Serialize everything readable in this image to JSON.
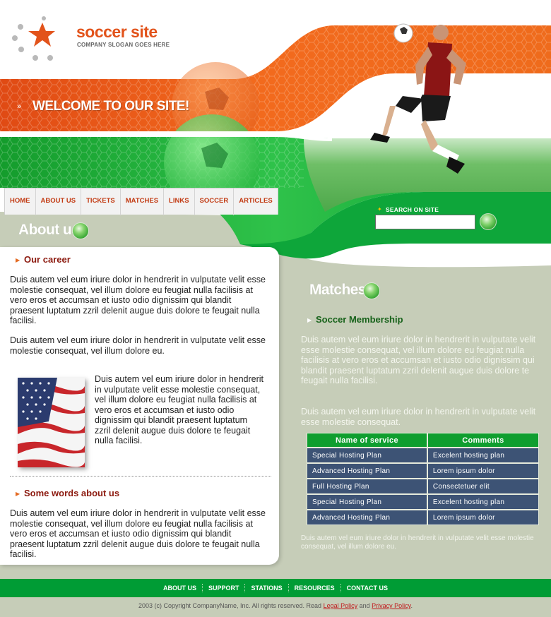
{
  "logo": {
    "name": "soccer site",
    "slogan": "COMPANY SLOGAN GOES HERE"
  },
  "banner": {
    "welcome": "WELCOME TO OUR SITE!"
  },
  "nav": {
    "items": [
      "HOME",
      "ABOUT US",
      "TICKETS",
      "MATCHES",
      "LINKS",
      "SOCCER",
      "ARTICLES"
    ]
  },
  "search": {
    "label": "SEARCH ON SITE",
    "value": ""
  },
  "about": {
    "title": "About us",
    "career_heading": "Our career",
    "para1": "Duis autem vel eum iriure dolor in hendrerit in vulputate velit esse molestie consequat, vel illum dolore eu feugiat nulla facilisis at vero eros et accumsan et iusto odio dignissim qui blandit praesent luptatum zzril delenit augue duis dolore te feugait nulla facilisi.",
    "para2": "Duis autem vel eum iriure dolor in hendrerit in vulputate velit esse molestie consequat, vel illum dolore eu.",
    "para3": "Duis autem vel eum iriure dolor in hendrerit in vulputate velit esse molestie consequat, vel illum dolore eu feugiat nulla facilisis at vero eros et accumsan et iusto odio dignissim qui blandit praesent luptatum zzril delenit augue duis dolore te feugait nulla facilisi.",
    "words_heading": "Some words about us",
    "para4": "Duis autem vel eum iriure dolor in hendrerit in vulputate velit esse molestie consequat, vel illum dolore eu feugiat nulla facilisis at vero eros et accumsan et iusto odio dignissim qui blandit praesent luptatum zzril delenit augue duis dolore te feugait nulla facilisi."
  },
  "matches": {
    "title": "Matches",
    "membership_heading": "Soccer Membership",
    "para1": "Duis autem vel eum iriure dolor in hendrerit in vulputate velit esse molestie consequat, vel illum dolore eu feugiat nulla facilisis at vero eros et accumsan et iusto odio dignissim qui blandit praesent luptatum zzril delenit augue duis dolore te feugait nulla facilisi.",
    "para2": "Duis autem vel eum iriure dolor in hendrerit in vulputate velit esse molestie consequat.",
    "table": {
      "headers": [
        "Name of service",
        "Comments"
      ],
      "rows": [
        [
          "Special Hosting Plan",
          "Excelent hosting plan"
        ],
        [
          "Advanced Hosting Plan",
          "Lorem ipsum dolor"
        ],
        [
          "Full Hosting Plan",
          "Consectetuer elit"
        ],
        [
          "Special Hosting Plan",
          "Excelent hosting plan"
        ],
        [
          "Advanced Hosting Plan",
          "Lorem ipsum dolor"
        ]
      ]
    },
    "small_text": "Duis autem vel eum iriure dolor in hendrerit in vulputate velit esse molestie consequat, vel illum dolore eu."
  },
  "footer": {
    "links": [
      "ABOUT US",
      "SUPPORT",
      "STATIONS",
      "RESOURCES",
      "CONTACT US"
    ],
    "copyright_prefix": "2003 (c) Copyright CompanyName, Inc. All rights reserved. Read",
    "legal_label": "Legal Policy",
    "and_label": "and",
    "privacy_label": "Privacy Policy",
    "period": "."
  },
  "colors": {
    "orange": "#e2531b",
    "green": "#009c35",
    "table_header": "#0f9e2f",
    "table_row": "#3d5375",
    "page_bg": "#c6cdb8"
  }
}
